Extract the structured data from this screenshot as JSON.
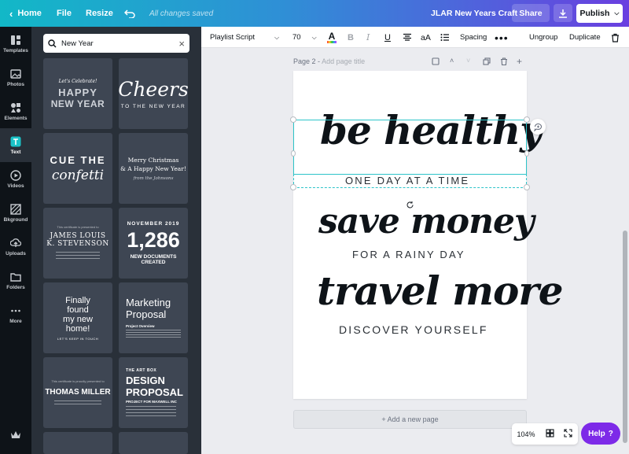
{
  "topbar": {
    "home_label": "Home",
    "file_label": "File",
    "resize_label": "Resize",
    "save_status": "All changes saved",
    "doc_title": "JLAR New Years Craft",
    "share_label": "Share",
    "publish_label": "Publish",
    "accent": "#7d2ae8"
  },
  "rail": {
    "items": [
      {
        "label": "Templates",
        "icon": "templates-icon"
      },
      {
        "label": "Photos",
        "icon": "photos-icon"
      },
      {
        "label": "Elements",
        "icon": "elements-icon"
      },
      {
        "label": "Text",
        "icon": "text-icon"
      },
      {
        "label": "Videos",
        "icon": "videos-icon"
      },
      {
        "label": "Bkground",
        "icon": "background-icon"
      },
      {
        "label": "Uploads",
        "icon": "uploads-icon"
      },
      {
        "label": "Folders",
        "icon": "folders-icon"
      },
      {
        "label": "More",
        "icon": "more-icon"
      }
    ]
  },
  "panel": {
    "search_value": "New Year",
    "tiles": {
      "t1": {
        "small": "Let's Celebrate!",
        "big1": "HAPPY",
        "big2": "NEW YEAR"
      },
      "t2": {
        "big": "Cheers",
        "small": "TO THE NEW YEAR"
      },
      "t3": {
        "big1": "CUE THE",
        "big2": "confetti"
      },
      "t4": {
        "l1": "Merry Christmas",
        "l2": "& A Happy New Year!",
        "l3": "from the Johnsons"
      },
      "t5": {
        "small1": "This certificate is presented to",
        "name1": "JAMES LOUIS",
        "name2": "K. STEVENSON"
      },
      "t6": {
        "top": "NOVEMBER 2019",
        "num": "1,286",
        "b1": "NEW DOCUMENTS",
        "b2": "CREATED"
      },
      "t7": {
        "l1": "Finally",
        "l2": "found",
        "l3": "my new",
        "l4": "home!",
        "small": "LET'S KEEP IN TOUCH"
      },
      "t8": {
        "l1": "Marketing",
        "l2": "Proposal",
        "small": "Project Overview"
      },
      "t9": {
        "small": "This certificate is proudly presented to",
        "name": "THOMAS MILLER"
      },
      "t10": {
        "top": "THE ART BOX",
        "l1": "DESIGN",
        "l2": "PROPOSAL",
        "sub": "PROJECT FOR MAXWELL INC"
      }
    }
  },
  "toolbar": {
    "font_family": "Playlist Script",
    "font_size": "70",
    "spacing_label": "Spacing",
    "ungroup_label": "Ungroup",
    "duplicate_label": "Duplicate",
    "text_color": "#0e1318"
  },
  "canvas": {
    "page_label": "Page 2",
    "page_title_placeholder": "Add page title",
    "line1": "be healthy",
    "sub1": "ONE DAY AT A TIME",
    "line2": "save money",
    "sub2": "FOR A RAINY DAY",
    "line3": "travel more",
    "sub3": "DISCOVER YOURSELF",
    "add_page_label": "+ Add a new page"
  },
  "footer": {
    "zoom": "104%",
    "help_label": "Help",
    "help_symbol": "?"
  }
}
